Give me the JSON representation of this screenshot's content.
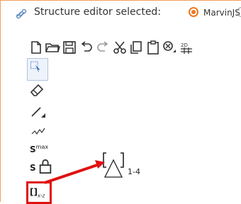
{
  "header": {
    "label": "Structure editor selected:",
    "selected_option": "MarvinJS"
  },
  "toolbar": {
    "icons": [
      "new-document-icon",
      "open-folder-icon",
      "save-icon",
      "undo-icon",
      "redo-icon",
      "cut-icon",
      "copy-icon",
      "paste-icon",
      "clear-zoom-icon",
      "clean-2d-icon"
    ]
  },
  "left_tools": {
    "items": [
      "rectangle-select-icon",
      "eraser-icon",
      "single-bond-icon",
      "chain-icon",
      "s-max-icon",
      "s-lock-icon",
      "bracket-xz-icon"
    ],
    "smax_label": "S",
    "smax_sup": "max",
    "slock_label": "S",
    "bracket_label": "[]",
    "bracket_sub": "x-z"
  },
  "canvas": {
    "bracket_repeat_label": "1-4"
  },
  "colors": {
    "accent": "#f07820",
    "highlight": "#e01010"
  }
}
